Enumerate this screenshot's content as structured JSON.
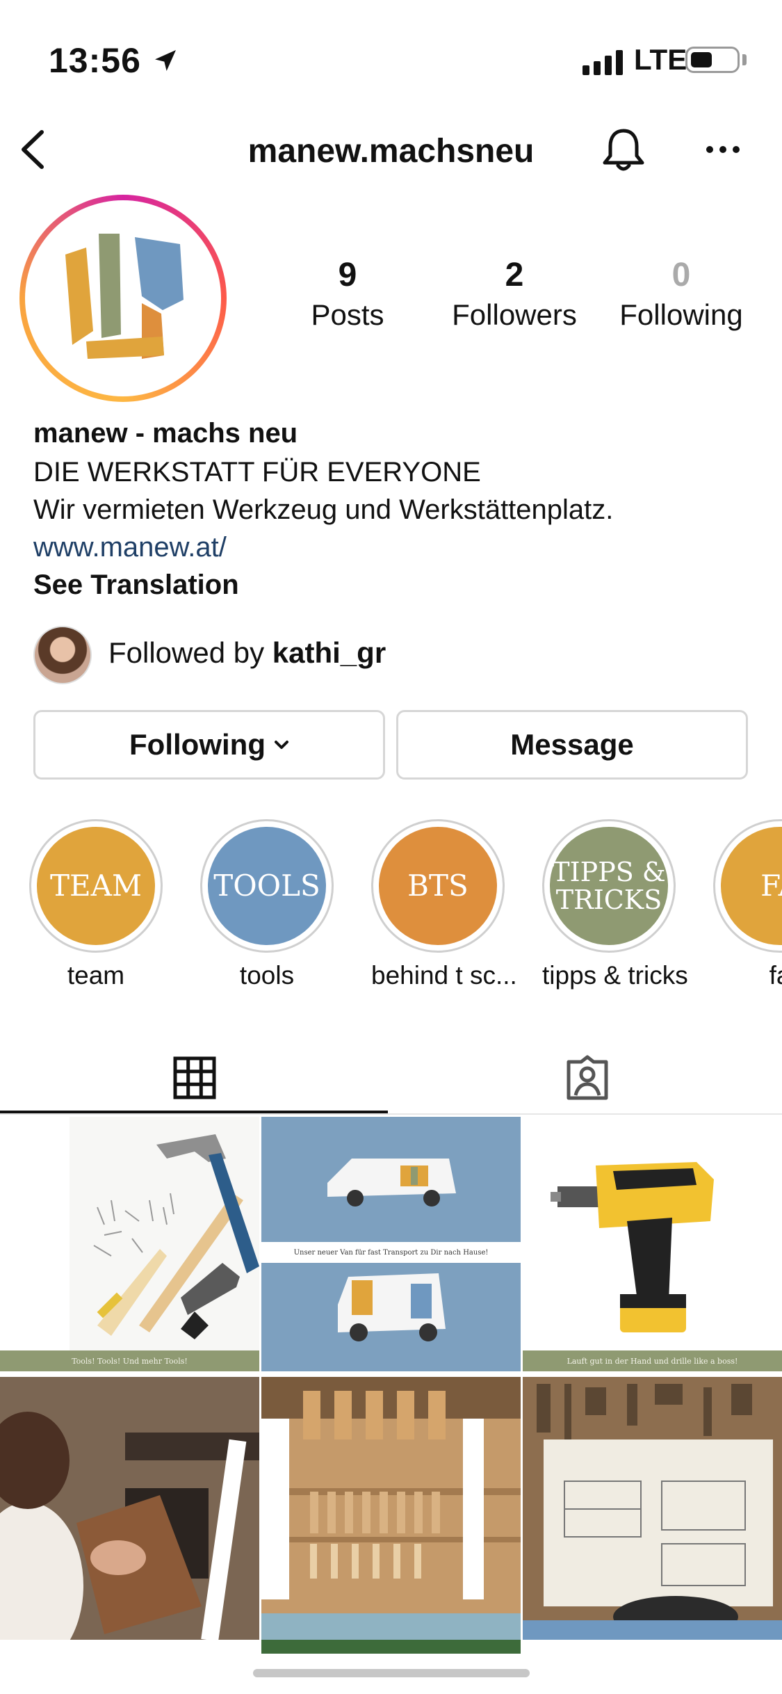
{
  "status_bar": {
    "time": "13:56",
    "network": "LTE"
  },
  "header": {
    "username": "manew.machsneu"
  },
  "stats": [
    {
      "value": "9",
      "label": "Posts"
    },
    {
      "value": "2",
      "label": "Followers"
    },
    {
      "value": "0",
      "label": "Following"
    }
  ],
  "bio": {
    "name": "manew - machs neu",
    "tagline": "DIE WERKSTATT FÜR EVERYONE",
    "description": "Wir vermieten Werkzeug und Werkstättenplatz.",
    "link": "www.manew.at/",
    "translate": "See Translation"
  },
  "followed_by": {
    "prefix": "Followed by ",
    "user": "kathi_gr"
  },
  "buttons": {
    "following": "Following",
    "message": "Message"
  },
  "highlights": [
    {
      "circle_text": "TEAM",
      "label": "team",
      "color": "#e0a43c"
    },
    {
      "circle_text": "TOOLS",
      "label": "tools",
      "color": "#6f98c0"
    },
    {
      "circle_text": "BTS",
      "label": "behind t sc...",
      "color": "#de8f3d"
    },
    {
      "circle_text": "TIPPS & TRICKS",
      "label": "tipps & tricks",
      "color": "#8f9a72"
    },
    {
      "circle_text": "FA",
      "label": "fa",
      "color": "#e0a43c"
    }
  ],
  "posts": [
    {
      "caption": "Tools! Tools! Und mehr Tools!"
    },
    {
      "caption": "Unser neuer Van für fast Transport zu Dir nach Hause!"
    },
    {
      "caption": "Lauft gut in der Hand und drille like a boss!"
    }
  ],
  "colors": {
    "accent_green": "#8f9a72",
    "accent_blue": "#6f98c0",
    "accent_orange": "#de8f3d",
    "accent_yellow": "#e0a43c",
    "link": "#1f3f66"
  }
}
